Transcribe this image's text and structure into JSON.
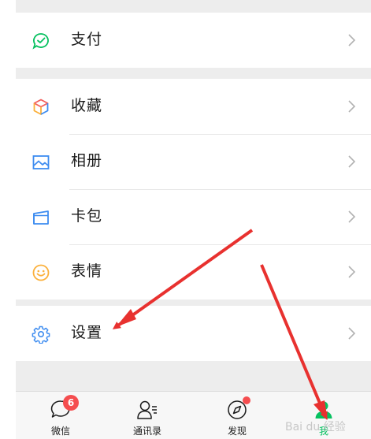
{
  "menu": {
    "pay": {
      "label": "支付",
      "icon": "pay-icon"
    },
    "favorites": {
      "label": "收藏",
      "icon": "favorites-cube-icon"
    },
    "album": {
      "label": "相册",
      "icon": "album-picture-icon"
    },
    "cards": {
      "label": "卡包",
      "icon": "card-wallet-icon"
    },
    "stickers": {
      "label": "表情",
      "icon": "smiley-icon"
    },
    "settings": {
      "label": "设置",
      "icon": "gear-icon"
    }
  },
  "tabbar": {
    "chats": {
      "label": "微信",
      "badge": "6",
      "icon": "chat-bubble-icon"
    },
    "contacts": {
      "label": "通讯录",
      "icon": "contacts-icon"
    },
    "discover": {
      "label": "发现",
      "icon": "compass-icon"
    },
    "me": {
      "label": "我",
      "icon": "person-icon"
    }
  },
  "watermark": "Bai du 经验",
  "colors": {
    "accent": "#07c160",
    "arrow": "#e8312f",
    "badge": "#f54d4f"
  }
}
